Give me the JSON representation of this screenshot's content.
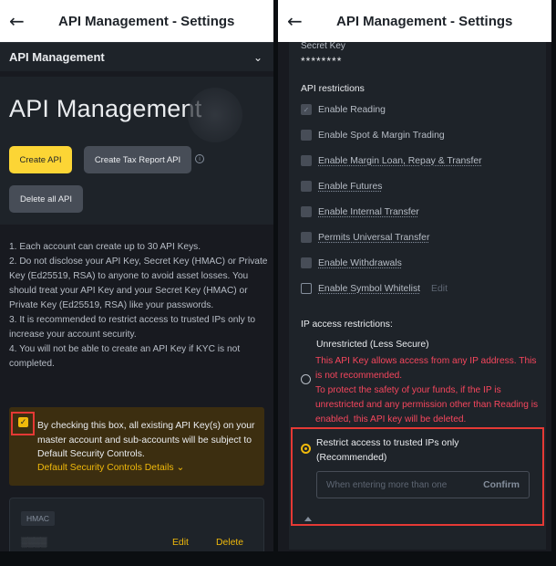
{
  "left": {
    "topbar": {
      "back_icon": "arrow-left-icon",
      "title": "API Management - Settings"
    },
    "accordion": {
      "title": "API Management",
      "chevron_icon": "chevron-down-icon"
    },
    "hero": {
      "title": "API Management",
      "create_api": "Create API",
      "create_tax_report_api": "Create Tax Report API",
      "info_icon": "info-icon",
      "delete_all_api": "Delete all API"
    },
    "notes": [
      "1. Each account can create up to 30 API Keys.",
      "2. Do not disclose your API Key, Secret Key (HMAC) or Private Key (Ed25519, RSA) to anyone to avoid asset losses. You should treat your API Key and your Secret Key (HMAC) or Private Key (Ed25519, RSA) like your passwords.",
      "3. It is recommended to restrict access to trusted IPs only to increase your account security.",
      "4. You will not be able to create an API Key if KYC is not completed."
    ],
    "consent": {
      "checked": true,
      "text": "By checking this box, all existing API Key(s) on your master account and sub-accounts will be subject to Default Security Controls.",
      "details_link": "Default Security Controls Details",
      "details_chevron": "⌄"
    },
    "key_card": {
      "tag": "HMAC",
      "label": "░░░░",
      "edit": "Edit",
      "delete": "Delete"
    }
  },
  "right": {
    "topbar": {
      "back_icon": "arrow-left-icon",
      "title": "API Management - Settings"
    },
    "secret_key": {
      "label": "Secret Key",
      "value": "********"
    },
    "restrictions_heading": "API restrictions",
    "permissions": [
      {
        "label": "Enable Reading",
        "checked": true,
        "disabled": true,
        "dotted": false
      },
      {
        "label": "Enable Spot & Margin Trading",
        "checked": false,
        "disabled": true,
        "dotted": false
      },
      {
        "label": "Enable Margin Loan, Repay & Transfer",
        "checked": false,
        "disabled": true,
        "dotted": true
      },
      {
        "label": "Enable Futures",
        "checked": false,
        "disabled": true,
        "dotted": true
      },
      {
        "label": "Enable Internal Transfer",
        "checked": false,
        "disabled": true,
        "dotted": true
      },
      {
        "label": "Permits Universal Transfer",
        "checked": false,
        "disabled": true,
        "dotted": true
      },
      {
        "label": "Enable Withdrawals",
        "checked": false,
        "disabled": true,
        "dotted": true
      },
      {
        "label": "Enable Symbol Whitelist",
        "checked": false,
        "disabled": false,
        "dotted": true,
        "edit": "Edit"
      }
    ],
    "ip_heading": "IP access restrictions:",
    "unrestricted": {
      "label": "Unrestricted (Less Secure)",
      "warning": "This API Key allows access from any IP address. This is not recommended.\nTo protect the safety of your funds, if the IP is unrestricted and any permission other than Reading is enabled, this API key will be deleted."
    },
    "restricted": {
      "label": "Restrict access to trusted IPs only (Recommended)",
      "selected": true,
      "input_placeholder": "When entering more than one",
      "confirm": "Confirm"
    }
  },
  "colors": {
    "accent": "#f0b90b",
    "button_yellow": "#fcd535",
    "danger": "#f6465d",
    "highlight_frame": "#e53935",
    "panel": "#1e2329",
    "background": "#181a20"
  }
}
